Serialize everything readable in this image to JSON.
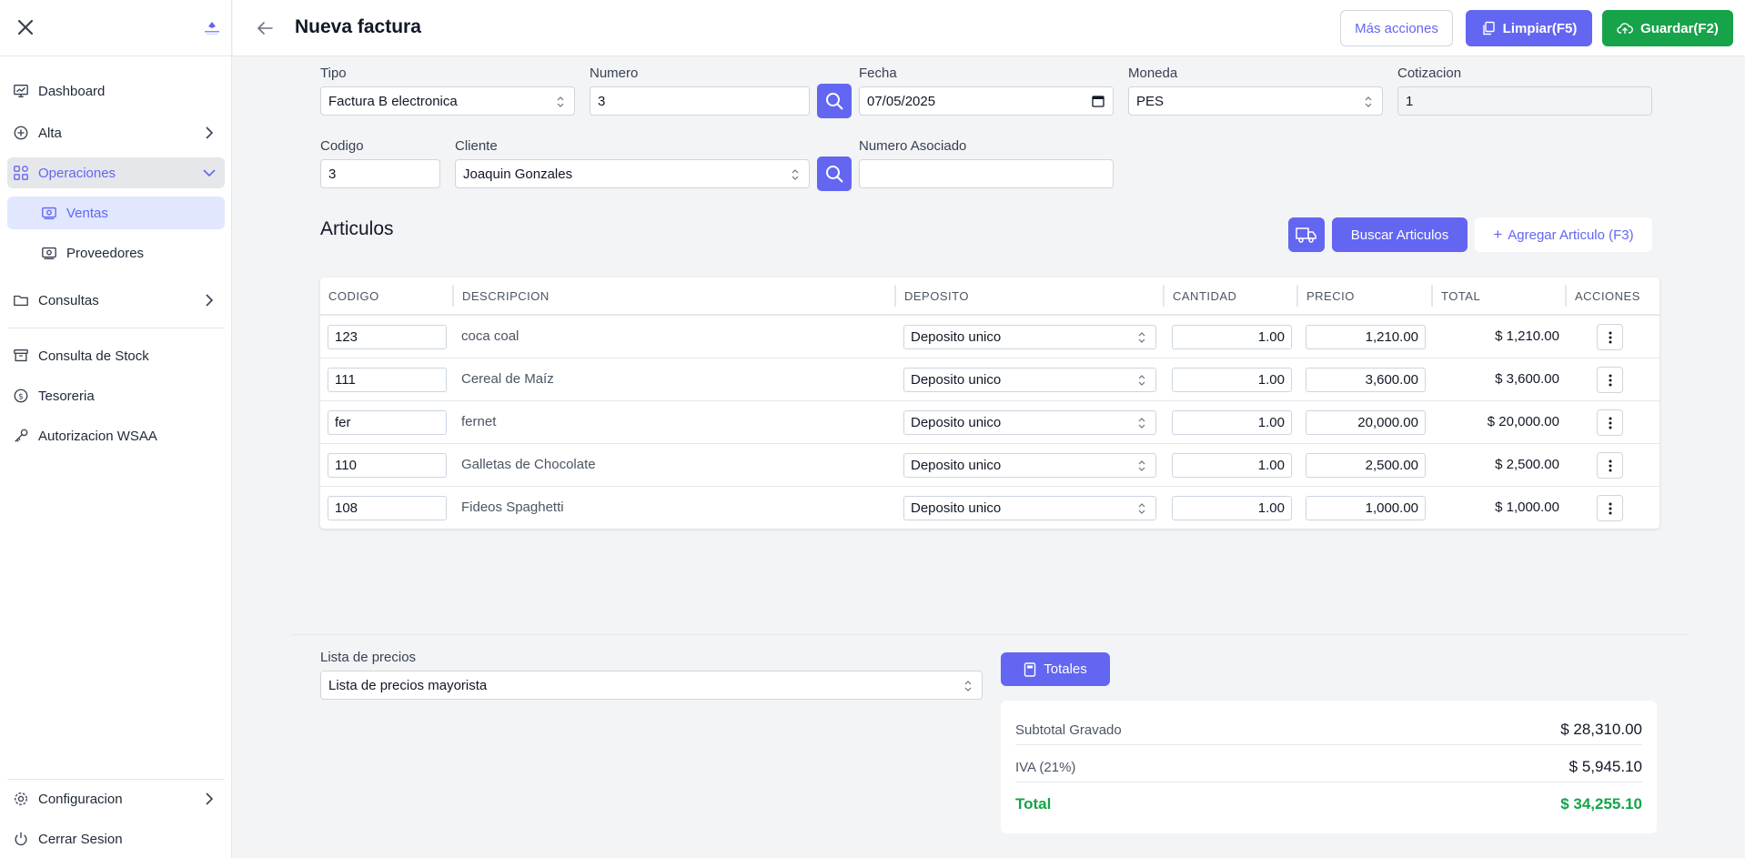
{
  "sidebar": {
    "items": [
      {
        "label": "Dashboard"
      },
      {
        "label": "Alta"
      },
      {
        "label": "Operaciones"
      },
      {
        "label": "Ventas"
      },
      {
        "label": "Proveedores"
      },
      {
        "label": "Consultas"
      },
      {
        "label": "Consulta de Stock"
      },
      {
        "label": "Tesoreria"
      },
      {
        "label": "Autorizacion WSAA"
      }
    ],
    "footer": [
      {
        "label": "Configuracion"
      },
      {
        "label": "Cerrar Sesion"
      }
    ]
  },
  "header": {
    "title": "Nueva factura",
    "more_label": "Más acciones",
    "clear_label": "Limpiar(F5)",
    "save_label": "Guardar(F2)"
  },
  "form": {
    "tipo": {
      "label": "Tipo",
      "value": "Factura B electronica"
    },
    "numero": {
      "label": "Numero",
      "value": "3"
    },
    "fecha": {
      "label": "Fecha",
      "value": "07/05/2025"
    },
    "moneda": {
      "label": "Moneda",
      "value": "PES"
    },
    "cotizacion": {
      "label": "Cotizacion",
      "value": "1"
    },
    "codigo": {
      "label": "Codigo",
      "value": "3"
    },
    "cliente": {
      "label": "Cliente",
      "value": "Joaquin Gonzales"
    },
    "numero_asociado": {
      "label": "Numero Asociado",
      "value": ""
    }
  },
  "articulos": {
    "title": "Articulos",
    "search_label": "Buscar Articulos",
    "add_label": "Agregar Articulo (F3)",
    "columns": [
      "CODIGO",
      "DESCRIPCION",
      "DEPOSITO",
      "CANTIDAD",
      "PRECIO",
      "TOTAL",
      "ACCIONES"
    ],
    "rows": [
      {
        "codigo": "123",
        "descripcion": "coca coal",
        "deposito": "Deposito unico",
        "cantidad": "1.00",
        "precio": "1,210.00",
        "total": "$ 1,210.00"
      },
      {
        "codigo": "111",
        "descripcion": "Cereal de Maíz",
        "deposito": "Deposito unico",
        "cantidad": "1.00",
        "precio": "3,600.00",
        "total": "$ 3,600.00"
      },
      {
        "codigo": "fer",
        "descripcion": "fernet",
        "deposito": "Deposito unico",
        "cantidad": "1.00",
        "precio": "20,000.00",
        "total": "$ 20,000.00"
      },
      {
        "codigo": "110",
        "descripcion": "Galletas de Chocolate",
        "deposito": "Deposito unico",
        "cantidad": "1.00",
        "precio": "2,500.00",
        "total": "$ 2,500.00"
      },
      {
        "codigo": "108",
        "descripcion": "Fideos Spaghetti",
        "deposito": "Deposito unico",
        "cantidad": "1.00",
        "precio": "1,000.00",
        "total": "$ 1,000.00"
      }
    ]
  },
  "precios": {
    "label": "Lista de precios",
    "value": "Lista de precios mayorista"
  },
  "totales": {
    "button_label": "Totales",
    "subtotal_label": "Subtotal Gravado",
    "subtotal_value": "$ 28,310.00",
    "iva_label": "IVA (21%)",
    "iva_value": "$ 5,945.10",
    "total_label": "Total",
    "total_value": "$ 34,255.10"
  },
  "colors": {
    "accent": "#6366f1",
    "success": "#16a34a"
  }
}
